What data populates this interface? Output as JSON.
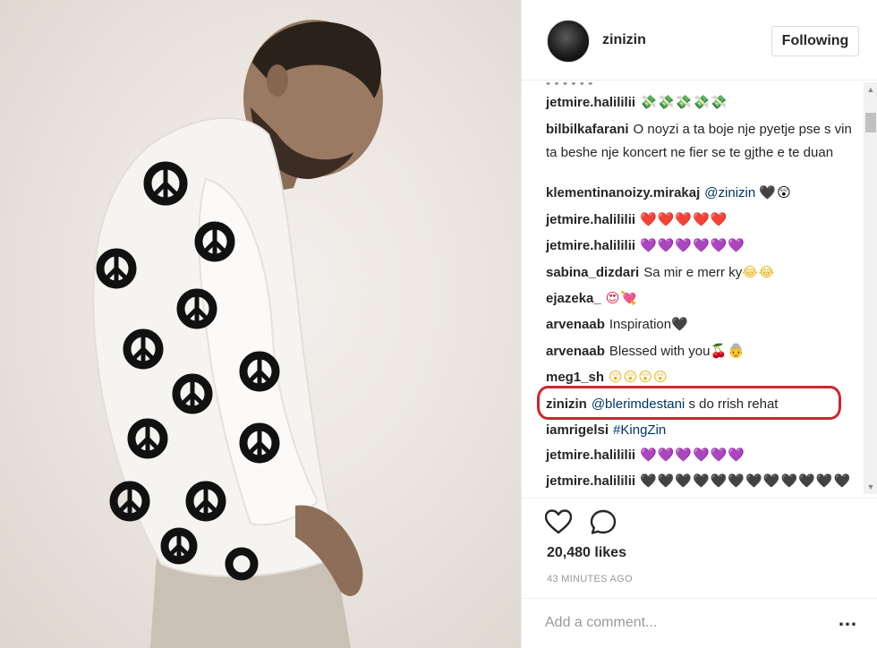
{
  "post": {
    "username": "zinizin",
    "follow_label": "Following",
    "likes": "20,480 likes",
    "timestamp": "43 MINUTES AGO",
    "comment_placeholder": "Add a comment...",
    "more_label": "…"
  },
  "comments": [
    {
      "user": "jetmire.halililii",
      "text": "",
      "emoji": "💸💸💸💸💸",
      "emoji_color": "em-green"
    },
    {
      "user": "bilbilkafarani",
      "text": "O noyzi a ta boje nje pyetje pse s vin ta beshe nje koncert ne fier se te gjthe e te duan",
      "emoji": "",
      "emoji_color": ""
    },
    {
      "user": "klementinanoizy.mirakaj",
      "mention": "@zinizin",
      "text": "",
      "emoji": "🖤😲",
      "emoji_color": "em-black"
    },
    {
      "user": "jetmire.halililii",
      "text": "",
      "emoji": "❤️❤️❤️❤️❤️",
      "emoji_color": "em-red"
    },
    {
      "user": "jetmire.halililii",
      "text": "",
      "emoji": "💜💜💜💜💜💜",
      "emoji_color": "em-purple"
    },
    {
      "user": "sabina_dizdari",
      "text": "Sa mir e merr ky",
      "emoji": "😂😂",
      "emoji_color": "em-yellow"
    },
    {
      "user": "ejazeka_",
      "text": "",
      "emoji": "😍💘",
      "emoji_color": "em-pink"
    },
    {
      "user": "arvenaab",
      "text": "Inspiration",
      "emoji": "🖤",
      "emoji_color": "em-black"
    },
    {
      "user": "arvenaab",
      "text": "Blessed with you",
      "emoji": "🍒👵",
      "emoji_color": "em-red"
    },
    {
      "user": "meg1_sh",
      "text": "",
      "emoji": "😲😲😲😲",
      "emoji_color": "em-yellow"
    },
    {
      "user": "zinizin",
      "mention": "@blerimdestani",
      "text": "s do rrish rehat",
      "emoji": "",
      "emoji_color": ""
    },
    {
      "user": "iamrigelsi",
      "mention": "#KingZin",
      "text": "",
      "emoji": "",
      "emoji_color": ""
    },
    {
      "user": "jetmire.halililii",
      "text": "",
      "emoji": "💜💜💜💜💜💜",
      "emoji_color": "em-purple"
    },
    {
      "user": "jetmire.halililii",
      "text": "",
      "emoji": "🖤🖤🖤🖤🖤🖤🖤🖤🖤🖤🖤🖤🖤",
      "emoji_color": "em-black"
    }
  ],
  "icons": {
    "heart": "heart-icon",
    "comment": "comment-bubble-icon",
    "more": "more-options-icon"
  },
  "colors": {
    "highlight": "#d1242f",
    "mention": "#003569",
    "text": "#262626",
    "muted": "#999999"
  }
}
